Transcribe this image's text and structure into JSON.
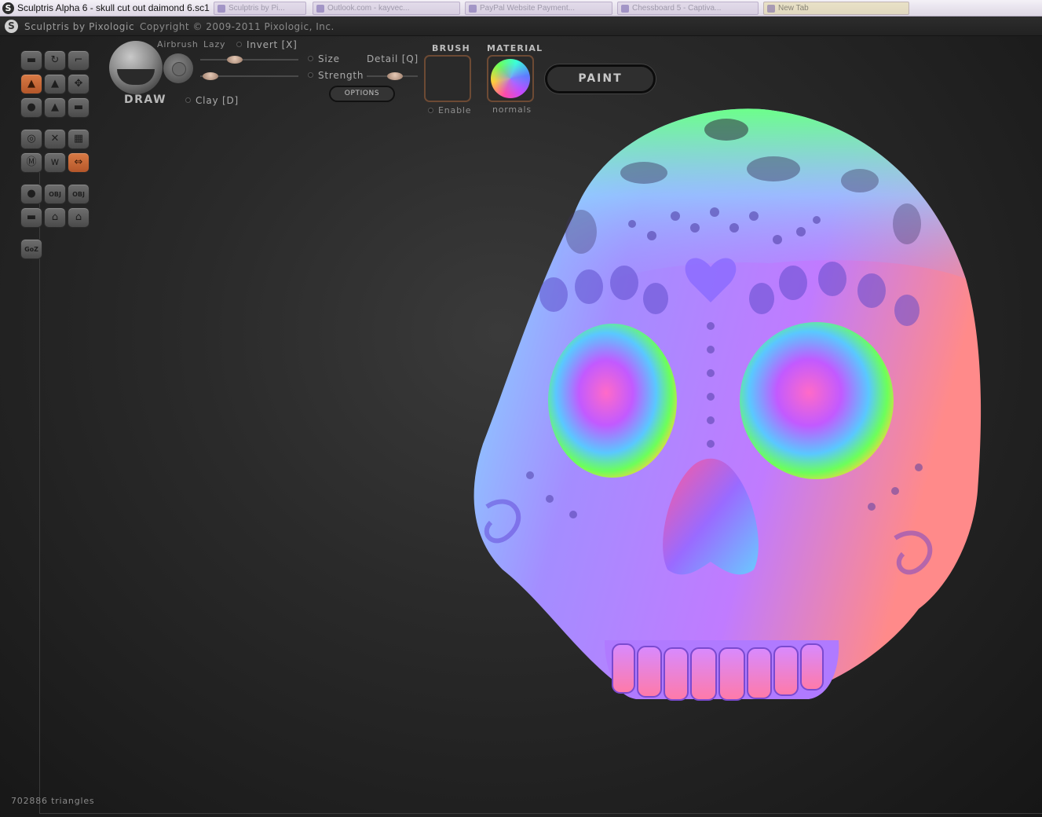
{
  "window": {
    "title": "Sculptris Alpha 6 - skull cut out daimond 6.sc1",
    "taskbar_tabs": [
      {
        "label": "Sculptris by Pi..."
      },
      {
        "label": "Outlook.com - kayvec..."
      },
      {
        "label": "PayPal Website Payment..."
      },
      {
        "label": "Chessboard 5 - Captiva..."
      },
      {
        "label": "New Tab"
      }
    ]
  },
  "header": {
    "app_name": "Sculptris by Pixologic",
    "copyright": "Copyright © 2009-2011 Pixologic, Inc."
  },
  "brush_panel": {
    "tool_name": "DRAW",
    "airbrush_label": "Airbrush",
    "lazy_label": "Lazy",
    "invert_label": "Invert [X]",
    "size_label": "Size",
    "detail_label": "Detail [Q]",
    "strength_label": "Strength",
    "clay_label": "Clay [D]",
    "options_label": "OPTIONS",
    "lazy_level": 0.35,
    "strength_level": 0.1,
    "detail_level": 0.55
  },
  "brush_section": {
    "title": "BRUSH",
    "enable_label": "Enable"
  },
  "material_section": {
    "title": "MATERIAL",
    "material_name": "normals"
  },
  "paint_button": {
    "label": "PAINT"
  },
  "tools": {
    "goz_label": "GoZ",
    "obj_label": "OBJ"
  },
  "status": {
    "triangles": "702886 triangles"
  },
  "colors": {
    "accent_active": "#c8683a",
    "panel_bg": "#2a2a2a",
    "viewport_bg": "#1b1b1b"
  }
}
